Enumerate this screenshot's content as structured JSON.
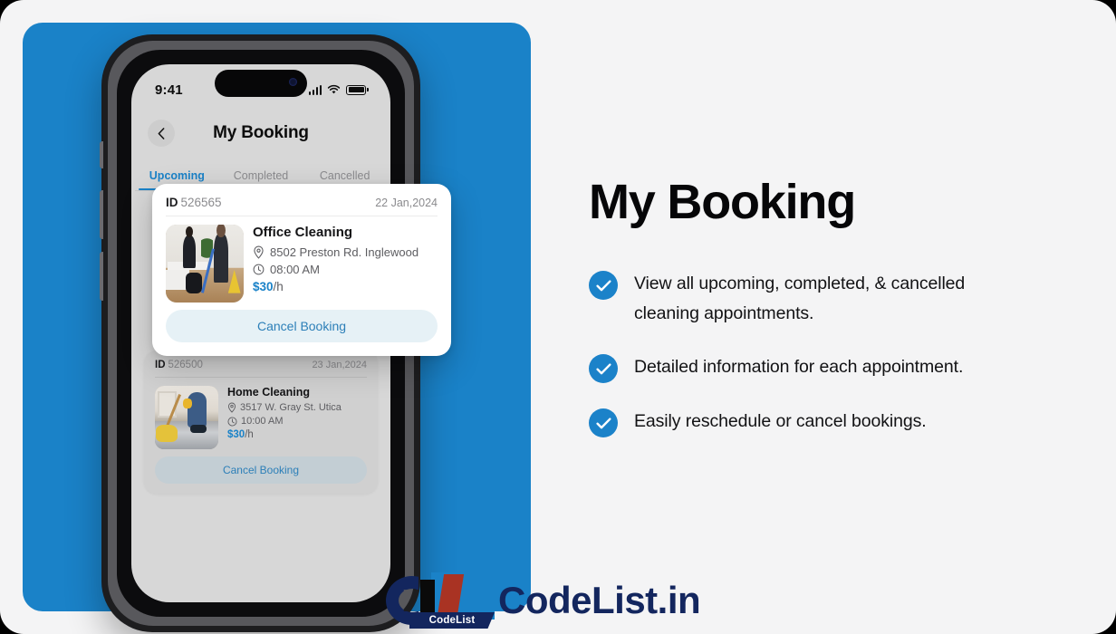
{
  "colors": {
    "brand_blue": "#1a82c8",
    "check_blue": "#1b82c9",
    "logo_navy": "#13265e",
    "logo_red": "#a93323",
    "page_bg": "#f4f4f5"
  },
  "phone": {
    "status_bar": {
      "time": "9:41",
      "signal_icon": "signal-bars-icon",
      "wifi_icon": "wifi-icon",
      "battery_icon": "battery-icon"
    },
    "header": {
      "back_icon": "chevron-left-icon",
      "title": "My Booking"
    },
    "tabs": [
      {
        "label": "Upcoming",
        "active": true
      },
      {
        "label": "Completed",
        "active": false
      },
      {
        "label": "Cancelled",
        "active": false
      }
    ],
    "bookings": [
      {
        "id_label": "ID",
        "id_value": "526565",
        "date": "22 Jan,2024",
        "service": "Office Cleaning",
        "location_icon": "map-pin-icon",
        "location": "8502 Preston Rd. Inglewood",
        "time_icon": "clock-icon",
        "time": "08:00 AM",
        "price": "$30",
        "price_unit": "/h",
        "action": "Cancel Booking",
        "thumb": "office-cleaning-photo"
      },
      {
        "id_label": "ID",
        "id_value": "526500",
        "date": "23 Jan,2024",
        "service": "Home Cleaning",
        "location_icon": "map-pin-icon",
        "location": "3517 W. Gray St. Utica",
        "time_icon": "clock-icon",
        "time": "10:00 AM",
        "price": "$30",
        "price_unit": "/h",
        "action": "Cancel Booking",
        "thumb": "home-cleaning-photo"
      }
    ]
  },
  "right": {
    "headline": "My Booking",
    "features": [
      {
        "icon": "check-circle-icon",
        "text": "View all upcoming, completed, & cancelled cleaning appointments."
      },
      {
        "icon": "check-circle-icon",
        "text": "Detailed information for each appointment."
      },
      {
        "icon": "check-circle-icon",
        "text": "Easily reschedule or cancel bookings."
      }
    ]
  },
  "logo": {
    "ribbon_text": "CodeList",
    "wordmark": "CodeList.in"
  }
}
